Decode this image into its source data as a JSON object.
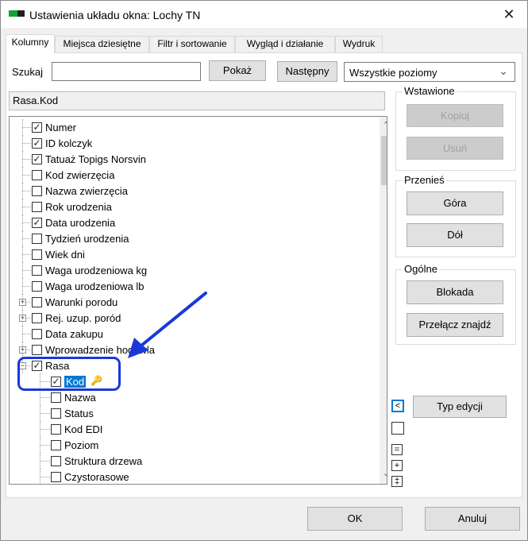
{
  "window": {
    "title": "Ustawienia układu okna: Lochy TN",
    "close_glyph": "✕",
    "brand_colors": [
      "#10a33a",
      "#222222"
    ]
  },
  "tabs": [
    "Kolumny",
    "Miejsca dziesiętne",
    "Filtr i sortowanie",
    "Wygląd i działanie",
    "Wydruk"
  ],
  "search": {
    "label": "Szukaj",
    "value": "",
    "show_button": "Pokaż",
    "next_button": "Następny",
    "level_select": "Wszystkie poziomy"
  },
  "path": "Rasa.Kod",
  "tree": [
    {
      "label": "Numer",
      "checked": true
    },
    {
      "label": "ID kolczyk",
      "checked": true
    },
    {
      "label": "Tatuaż Topigs Norsvin",
      "checked": true
    },
    {
      "label": "Kod zwierzęcia",
      "checked": false
    },
    {
      "label": "Nazwa zwierzęcia",
      "checked": false
    },
    {
      "label": "Rok urodzenia",
      "checked": false
    },
    {
      "label": "Data urodzenia",
      "checked": true
    },
    {
      "label": "Tydzień urodzenia",
      "checked": false
    },
    {
      "label": "Wiek dni",
      "checked": false
    },
    {
      "label": "Waga urodzeniowa kg",
      "checked": false
    },
    {
      "label": "Waga urodzeniowa lb",
      "checked": false
    },
    {
      "label": "Warunki porodu",
      "checked": false,
      "expander": "+"
    },
    {
      "label": "Rej. uzup. poród",
      "checked": false,
      "expander": "+"
    },
    {
      "label": "Data zakupu",
      "checked": false
    },
    {
      "label": "Wprowadzenie hodowla",
      "checked": false,
      "expander": "+"
    },
    {
      "label": "Rasa",
      "checked": true,
      "expander": "−"
    },
    {
      "label": "Kod",
      "checked": true,
      "child": true,
      "selected": true,
      "key": true
    },
    {
      "label": "Nazwa",
      "checked": false,
      "child": true
    },
    {
      "label": "Status",
      "checked": false,
      "child": true
    },
    {
      "label": "Kod EDI",
      "checked": false,
      "child": true
    },
    {
      "label": "Poziom",
      "checked": false,
      "child": true
    },
    {
      "label": "Struktura drzewa",
      "checked": false,
      "child": true
    },
    {
      "label": "Czystorasowe",
      "checked": false,
      "child": true
    }
  ],
  "groups": {
    "inserted": {
      "caption": "Wstawione",
      "copy": "Kopiuj",
      "remove": "Usuń"
    },
    "move": {
      "caption": "Przenieś",
      "up": "Góra",
      "down": "Dół"
    },
    "general": {
      "caption": "Ogólne",
      "lock": "Blokada",
      "toggle_find": "Przełącz znajdź"
    }
  },
  "edit_type_button": "Typ edycji",
  "small_buttons": {
    "left": "<",
    "equal": "=",
    "plus": "+",
    "plusminus": "‡"
  },
  "footer": {
    "ok": "OK",
    "cancel": "Anuluj"
  },
  "icons": {
    "check": "✓",
    "key": "🔑",
    "arrow_up": "⌃",
    "arrow_down": "⌄"
  },
  "annotation": {
    "color": "#1a38d9"
  }
}
